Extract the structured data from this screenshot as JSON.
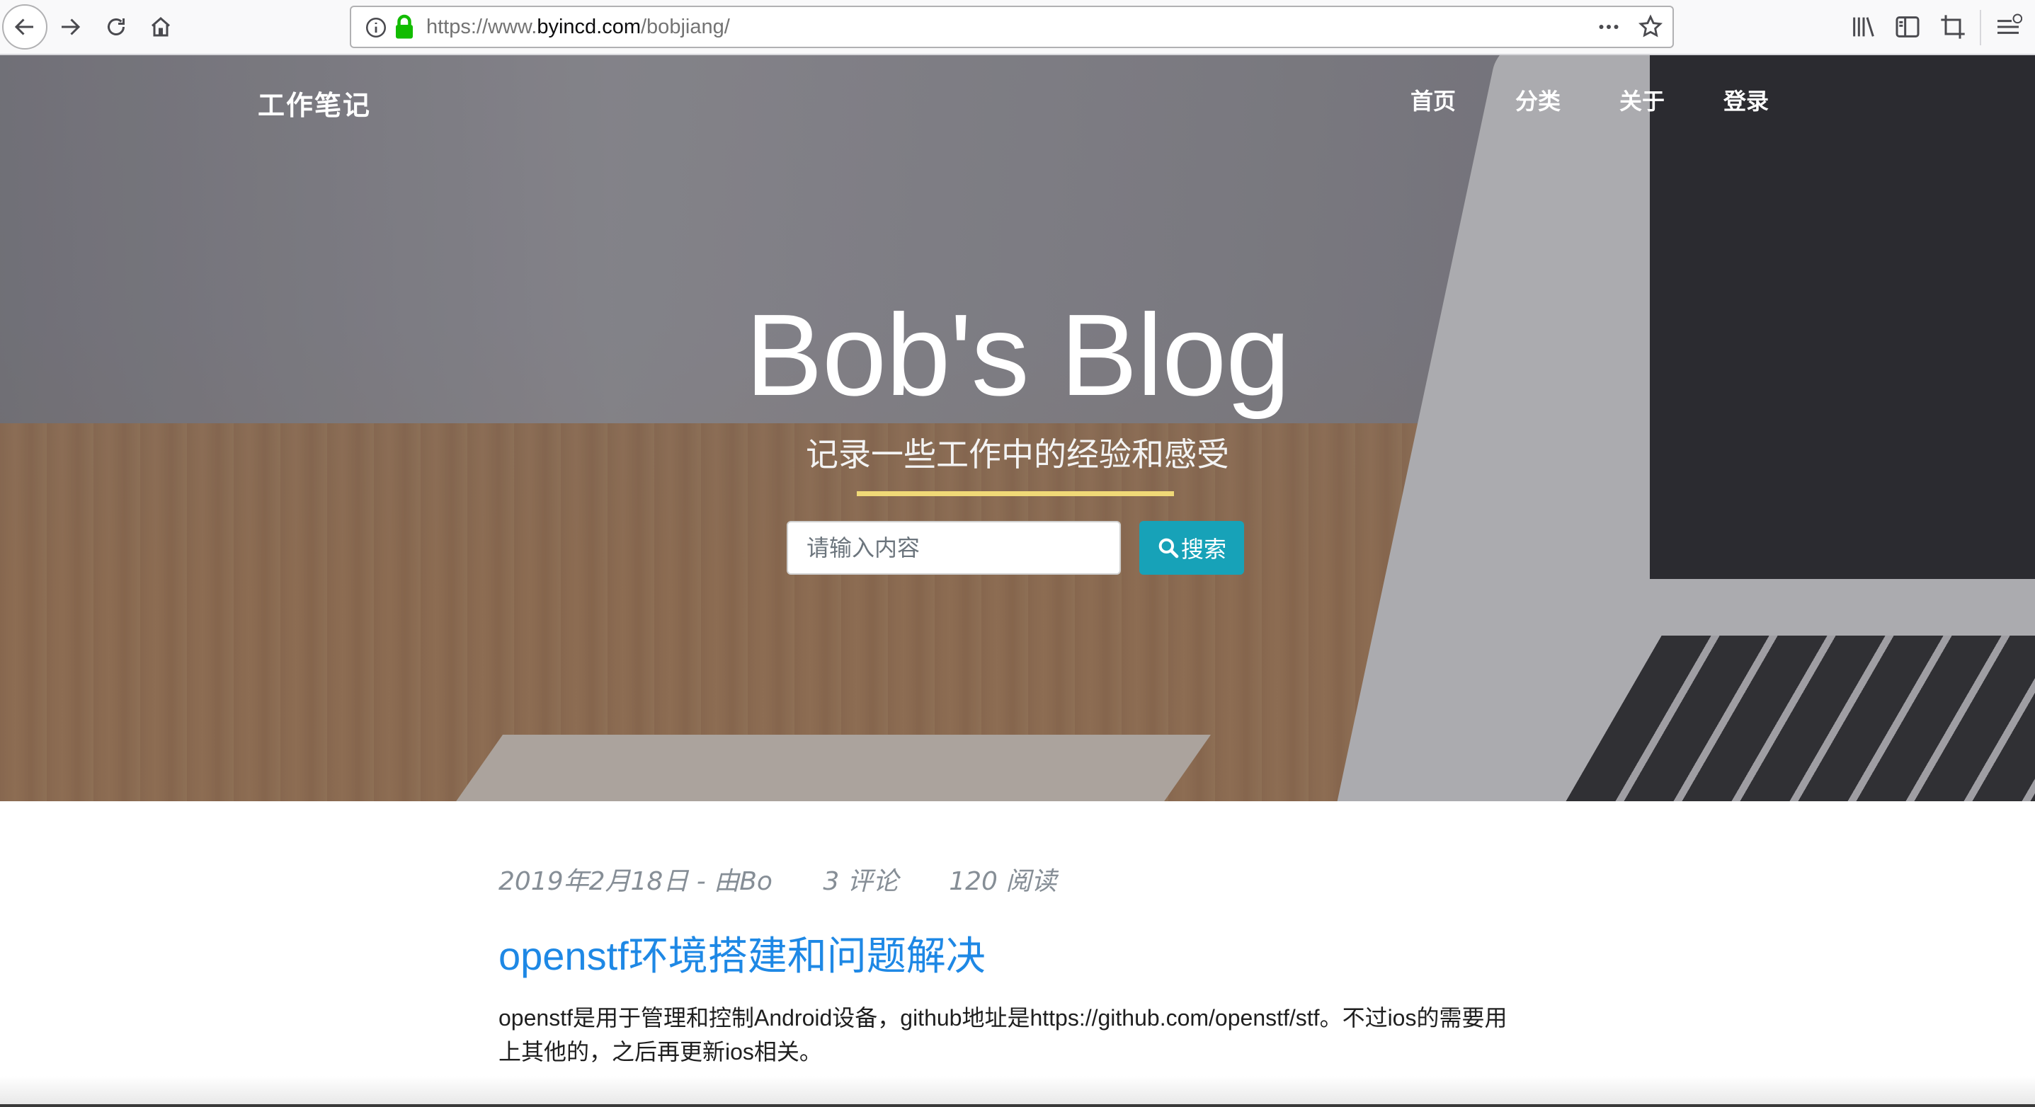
{
  "browser": {
    "url_prefix": "https://www.",
    "url_domain": "byincd.com",
    "url_path": "/bobjiang/"
  },
  "nav": {
    "brand": "工作笔记",
    "items": [
      {
        "label": "首页"
      },
      {
        "label": "分类"
      },
      {
        "label": "关于"
      },
      {
        "label": "登录"
      }
    ]
  },
  "hero": {
    "title": "Bob's Blog",
    "subtitle": "记录一些工作中的经验和感受",
    "divider_color": "#f0d977"
  },
  "search": {
    "placeholder": "请输入内容",
    "button_label": "搜索",
    "button_icon": "search-icon",
    "button_color": "#17a2b8"
  },
  "post": {
    "date_author": "2019年2月18日 - 由Bo",
    "comments": "3 评论",
    "reads": "120 阅读",
    "title": "openstf环境搭建和问题解决",
    "title_color": "#1e88e5",
    "excerpt": "openstf是用于管理和控制Android设备，github地址是https://github.com/openstf/stf。不过ios的需要用上其他的，之后再更新ios相关。"
  }
}
